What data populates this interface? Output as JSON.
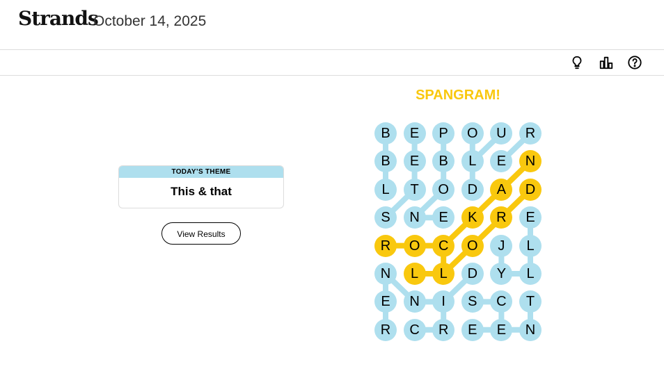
{
  "header": {
    "title": "Strands",
    "date": "October 14, 2025"
  },
  "toolbar": {
    "icons": [
      "lightbulb-icon",
      "stats-icon",
      "help-icon"
    ]
  },
  "theme": {
    "label": "TODAY’S THEME",
    "text": "This & that"
  },
  "actions": {
    "view_results_label": "View Results"
  },
  "spangram": {
    "label": "SPANGRAM!",
    "color": "#f9c80e"
  },
  "colors": {
    "found": "#aedfee",
    "spangram": "#f9c80e"
  },
  "board": {
    "rows": [
      [
        "B",
        "E",
        "P",
        "O",
        "U",
        "R"
      ],
      [
        "B",
        "E",
        "B",
        "L",
        "E",
        "N"
      ],
      [
        "L",
        "T",
        "O",
        "D",
        "A",
        "D"
      ],
      [
        "S",
        "N",
        "E",
        "K",
        "R",
        "E"
      ],
      [
        "R",
        "O",
        "C",
        "O",
        "J",
        "L"
      ],
      [
        "N",
        "L",
        "L",
        "D",
        "Y",
        "L"
      ],
      [
        "E",
        "N",
        "I",
        "S",
        "C",
        "T"
      ],
      [
        "R",
        "C",
        "R",
        "E",
        "E",
        "N"
      ]
    ],
    "states": [
      [
        "found",
        "found",
        "found",
        "found",
        "found",
        "found"
      ],
      [
        "found",
        "found",
        "found",
        "found",
        "found",
        "spangram"
      ],
      [
        "found",
        "found",
        "found",
        "found",
        "spangram",
        "spangram"
      ],
      [
        "found",
        "found",
        "found",
        "spangram",
        "spangram",
        "found"
      ],
      [
        "spangram",
        "spangram",
        "spangram",
        "spangram",
        "found",
        "found"
      ],
      [
        "found",
        "spangram",
        "spangram",
        "found",
        "found",
        "found"
      ],
      [
        "found",
        "found",
        "found",
        "found",
        "found",
        "found"
      ],
      [
        "found",
        "found",
        "found",
        "found",
        "found",
        "found"
      ]
    ],
    "paths": [
      {
        "type": "found",
        "cells": [
          [
            0,
            0
          ],
          [
            1,
            0
          ],
          [
            2,
            0
          ]
        ]
      },
      {
        "type": "found",
        "cells": [
          [
            0,
            1
          ],
          [
            1,
            1
          ],
          [
            2,
            1
          ]
        ]
      },
      {
        "type": "found",
        "cells": [
          [
            3,
            0
          ],
          [
            2,
            1
          ]
        ]
      },
      {
        "type": "found",
        "cells": [
          [
            0,
            2
          ],
          [
            1,
            2
          ],
          [
            2,
            2
          ],
          [
            3,
            1
          ]
        ]
      },
      {
        "type": "found",
        "cells": [
          [
            3,
            1
          ],
          [
            3,
            2
          ]
        ]
      },
      {
        "type": "found",
        "cells": [
          [
            0,
            3
          ],
          [
            1,
            3
          ],
          [
            2,
            3
          ]
        ]
      },
      {
        "type": "found",
        "cells": [
          [
            0,
            4
          ],
          [
            1,
            3
          ]
        ]
      },
      {
        "type": "found",
        "cells": [
          [
            0,
            5
          ],
          [
            1,
            4
          ]
        ]
      },
      {
        "type": "found",
        "cells": [
          [
            3,
            5
          ],
          [
            4,
            5
          ],
          [
            5,
            5
          ],
          [
            5,
            4
          ],
          [
            4,
            4
          ]
        ]
      },
      {
        "type": "found",
        "cells": [
          [
            5,
            0
          ],
          [
            6,
            0
          ],
          [
            7,
            0
          ]
        ]
      },
      {
        "type": "found",
        "cells": [
          [
            5,
            0
          ],
          [
            6,
            1
          ],
          [
            6,
            2
          ],
          [
            5,
            3
          ]
        ]
      },
      {
        "type": "found",
        "cells": [
          [
            6,
            2
          ],
          [
            7,
            2
          ]
        ]
      },
      {
        "type": "found",
        "cells": [
          [
            6,
            3
          ],
          [
            6,
            4
          ],
          [
            7,
            4
          ],
          [
            7,
            3
          ]
        ]
      },
      {
        "type": "found",
        "cells": [
          [
            7,
            1
          ],
          [
            7,
            2
          ]
        ]
      },
      {
        "type": "found",
        "cells": [
          [
            6,
            5
          ],
          [
            7,
            5
          ],
          [
            7,
            4
          ]
        ]
      },
      {
        "type": "spangram",
        "cells": [
          [
            4,
            0
          ],
          [
            4,
            1
          ],
          [
            4,
            2
          ],
          [
            3,
            3
          ],
          [
            2,
            4
          ],
          [
            1,
            5
          ]
        ]
      },
      {
        "type": "spangram",
        "cells": [
          [
            4,
            2
          ],
          [
            5,
            2
          ],
          [
            5,
            1
          ]
        ]
      },
      {
        "type": "spangram",
        "cells": [
          [
            2,
            5
          ],
          [
            3,
            4
          ],
          [
            4,
            3
          ],
          [
            5,
            2
          ]
        ]
      }
    ]
  }
}
